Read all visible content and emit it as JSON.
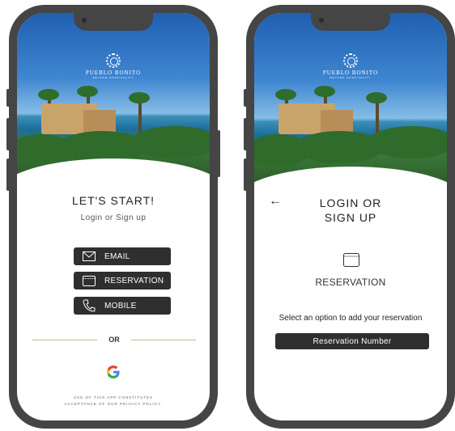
{
  "brand": {
    "name": "PUEBLO BONITO",
    "tagline": "BEYOND HOSPITALITY"
  },
  "screen1": {
    "title": "LET'S START!",
    "subtitle": "Login or Sign up",
    "buttons": [
      {
        "label": "EMAIL",
        "icon": "envelope-icon"
      },
      {
        "label": "RESERVATION",
        "icon": "calendar-icon"
      },
      {
        "label": "MOBILE",
        "icon": "phone-icon"
      }
    ],
    "divider_text": "OR",
    "social_icon": "google-icon",
    "legal_line1": "USE OF THIS APP CONSTITUTES",
    "legal_line2": "ACCEPTANCE OF OUR PRIVACY POLICY."
  },
  "screen2": {
    "back_icon": "back-arrow-icon",
    "title_line1": "LOGIN OR",
    "title_line2": "SIGN UP",
    "option_icon": "calendar-icon",
    "option_label": "RESERVATION",
    "instruction": "Select an option to add your reservation",
    "field_button": "Reservation Number"
  },
  "colors": {
    "frame": "#454545",
    "button": "#2f2f2f",
    "divider_gold": "#c9b38a"
  }
}
